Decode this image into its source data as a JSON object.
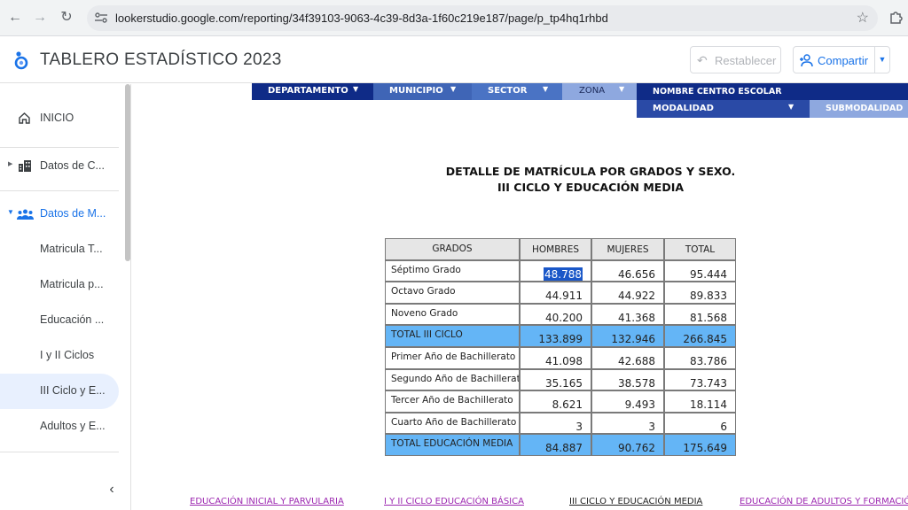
{
  "browser": {
    "url": "lookerstudio.google.com/reporting/34f39103-9063-4c39-8d3a-1f60c219e187/page/p_tp4hq1rhbd"
  },
  "header": {
    "title": "TABLERO ESTADÍSTICO 2023",
    "reset_label": "Restablecer",
    "share_label": "Compartir"
  },
  "sidebar": {
    "items": [
      {
        "label": "INICIO",
        "icon": "home-icon"
      },
      {
        "label": "Datos de C...",
        "icon": "building-icon"
      },
      {
        "label": "Datos de M...",
        "icon": "people-icon"
      },
      {
        "label": "Matricula T..."
      },
      {
        "label": "Matricula p..."
      },
      {
        "label": "Educación ..."
      },
      {
        "label": "I y II Ciclos"
      },
      {
        "label": "III Ciclo y E...",
        "active": true
      },
      {
        "label": "Adultos y E..."
      }
    ]
  },
  "filters": {
    "departamento": "DEPARTAMENTO",
    "municipio": "MUNICIPIO",
    "sector": "SECTOR",
    "zona": "ZONA",
    "centro": "NOMBRE CENTRO ESCOLAR",
    "modalidad": "MODALIDAD",
    "submodalidad": "SUBMODALIDAD"
  },
  "report": {
    "title_line1": "DETALLE DE MATRÍCULA POR GRADOS Y SEXO.",
    "title_line2": "III CICLO Y EDUCACIÓN MEDIA"
  },
  "table": {
    "headers": [
      "GRADOS",
      "HOMBRES",
      "MUJERES",
      "TOTAL"
    ],
    "rows": [
      [
        "Séptimo Grado",
        "48.788",
        "46.656",
        "95.444"
      ],
      [
        "Octavo Grado",
        "44.911",
        "44.922",
        "89.833"
      ],
      [
        "Noveno Grado",
        "40.200",
        "41.368",
        "81.568"
      ],
      [
        "TOTAL III CICLO",
        "133.899",
        "132.946",
        "266.845"
      ],
      [
        "Primer Año de Bachillerato",
        "41.098",
        "42.688",
        "83.786"
      ],
      [
        "Segundo Año de Bachillerato",
        "35.165",
        "38.578",
        "73.743"
      ],
      [
        "Tercer Año de Bachillerato",
        "8.621",
        "9.493",
        "18.114"
      ],
      [
        "Cuarto Año de Bachillerato",
        "3",
        "3",
        "6"
      ],
      [
        "TOTAL EDUCACIÓN MEDIA",
        "84.887",
        "90.762",
        "175.649"
      ]
    ]
  },
  "bottom_links": [
    "EDUCACIÓN INICIAL Y PARVULARIA",
    "I Y II CICLO EDUCACIÓN BÁSICA",
    "III CICLO Y EDUCACIÓN MEDIA",
    "EDUCACIÓN DE ADULTOS Y FORMACIÓ"
  ],
  "colors": {
    "filter_dark": "#0f2b87",
    "filter_mid": "#3f65b6",
    "filter_light": "#8ea8df",
    "total_row": "#64b5f6",
    "selected_cell": "#1a57c8",
    "link_purple": "#9c27b0"
  }
}
